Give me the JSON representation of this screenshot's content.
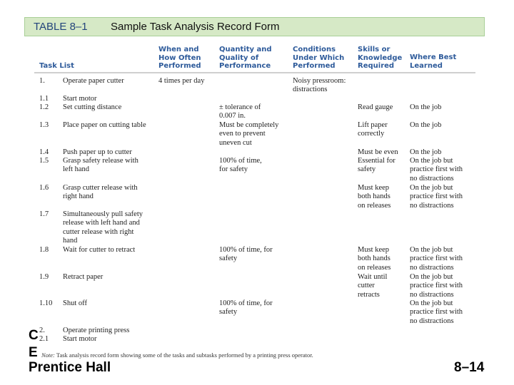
{
  "title_bar": {
    "table_number": "TABLE 8–1",
    "title": "Sample Task Analysis Record Form"
  },
  "table": {
    "headers": {
      "task_list": "Task List",
      "when": [
        "When and",
        "How Often",
        "Performed"
      ],
      "quantity": [
        "Quantity and",
        "Quality of",
        "Performance"
      ],
      "conditions": [
        "Conditions",
        "Under Which",
        "Performed"
      ],
      "skills": [
        "Skills or",
        "Knowledge",
        "Required"
      ],
      "where": [
        "Where Best",
        "Learned"
      ]
    },
    "rows": [
      {
        "num": "1.",
        "task": [
          "Operate paper cutter"
        ],
        "when": [
          "4 times per day"
        ],
        "quantity": [],
        "conditions": [
          "Noisy pressroom:",
          "distractions"
        ],
        "skills": [],
        "where": []
      },
      {
        "num": "1.1",
        "task": [
          "Start motor"
        ],
        "when": [],
        "quantity": [],
        "conditions": [],
        "skills": [],
        "where": []
      },
      {
        "num": "1.2",
        "task": [
          "Set cutting distance"
        ],
        "when": [],
        "quantity": [
          "± tolerance of",
          "0.007 in."
        ],
        "conditions": [],
        "skills": [
          "Read gauge"
        ],
        "where": [
          "On the job"
        ]
      },
      {
        "num": "1.3",
        "task": [
          "Place paper on cutting table"
        ],
        "when": [],
        "quantity": [
          "Must be completely",
          "even to prevent",
          "uneven cut"
        ],
        "conditions": [],
        "skills": [
          "Lift paper",
          "correctly"
        ],
        "where": [
          "On the job"
        ]
      },
      {
        "num": "1.4",
        "task": [
          "Push paper up to cutter"
        ],
        "when": [],
        "quantity": [],
        "conditions": [],
        "skills": [
          "Must be even"
        ],
        "where": [
          "On the job"
        ]
      },
      {
        "num": "1.5",
        "task": [
          "Grasp safety release with",
          "left hand"
        ],
        "when": [],
        "quantity": [
          "100% of time,",
          "for safety"
        ],
        "conditions": [],
        "skills": [
          "Essential for",
          "safety"
        ],
        "where": [
          "On the job but",
          "practice first with",
          "no distractions"
        ]
      },
      {
        "num": "1.6",
        "task": [
          "Grasp cutter release with",
          "right hand"
        ],
        "when": [],
        "quantity": [],
        "conditions": [],
        "skills": [
          "Must keep",
          "both hands",
          "on releases"
        ],
        "where": [
          "On the job but",
          "practice first with",
          "no distractions"
        ]
      },
      {
        "num": "1.7",
        "task": [
          "Simultaneously pull safety",
          "release with left hand and",
          "cutter release with right",
          "hand"
        ],
        "when": [],
        "quantity": [],
        "conditions": [],
        "skills": [],
        "where": []
      },
      {
        "num": "1.8",
        "task": [
          "Wait for cutter to retract"
        ],
        "when": [],
        "quantity": [
          "100% of time, for",
          "safety"
        ],
        "conditions": [],
        "skills": [
          "Must keep",
          "both hands",
          "on releases"
        ],
        "where": [
          "On the job but",
          "practice first with",
          "no distractions"
        ]
      },
      {
        "num": "1.9",
        "task": [
          "Retract paper"
        ],
        "when": [],
        "quantity": [],
        "conditions": [],
        "skills": [
          "Wait until",
          "cutter",
          "retracts"
        ],
        "where": [
          "On the job but",
          "practice first with",
          "no distractions"
        ]
      },
      {
        "num": "1.10",
        "task": [
          "Shut off"
        ],
        "when": [],
        "quantity": [
          "100% of time, for",
          "safety"
        ],
        "conditions": [],
        "skills": [],
        "where": [
          "On the job but",
          "practice first with",
          "no distractions"
        ]
      },
      {
        "num": "2.",
        "task": [
          "Operate printing press"
        ],
        "when": [],
        "quantity": [],
        "conditions": [],
        "skills": [],
        "where": []
      },
      {
        "num": "2.1",
        "task": [
          "Start motor"
        ],
        "when": [],
        "quantity": [],
        "conditions": [],
        "skills": [],
        "where": []
      }
    ],
    "note_label": "Note:",
    "note_text": "Task analysis record form showing some of the tasks and subtasks performed by a printing press operator."
  },
  "footer": {
    "line1": "C",
    "line2": "E",
    "publisher": "Prentice Hall",
    "page": "8–14"
  }
}
